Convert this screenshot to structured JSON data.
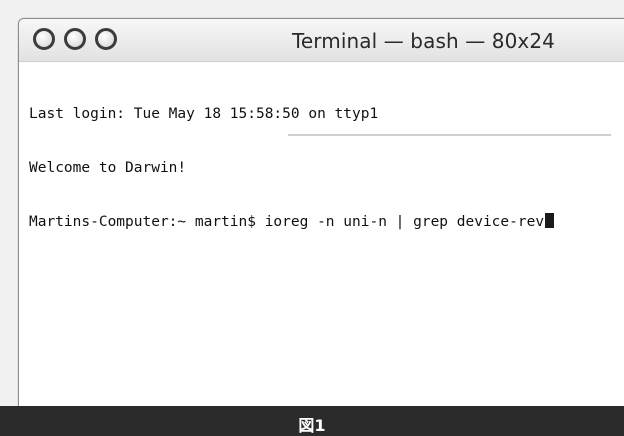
{
  "window": {
    "title": "Terminal — bash — 80x24",
    "traffic_lights": [
      "close-button",
      "minimize-button",
      "zoom-button"
    ]
  },
  "terminal": {
    "lines": [
      "Last login: Tue May 18 15:58:50 on ttyp1",
      "Welcome to Darwin!"
    ],
    "prompt": "Martins-Computer:~ martin$ ",
    "command": "ioreg -n uni-n | grep device-rev"
  },
  "caption": "図1",
  "colors": {
    "caption_bar": "#2b2b2b",
    "terminal_text": "#111111"
  }
}
